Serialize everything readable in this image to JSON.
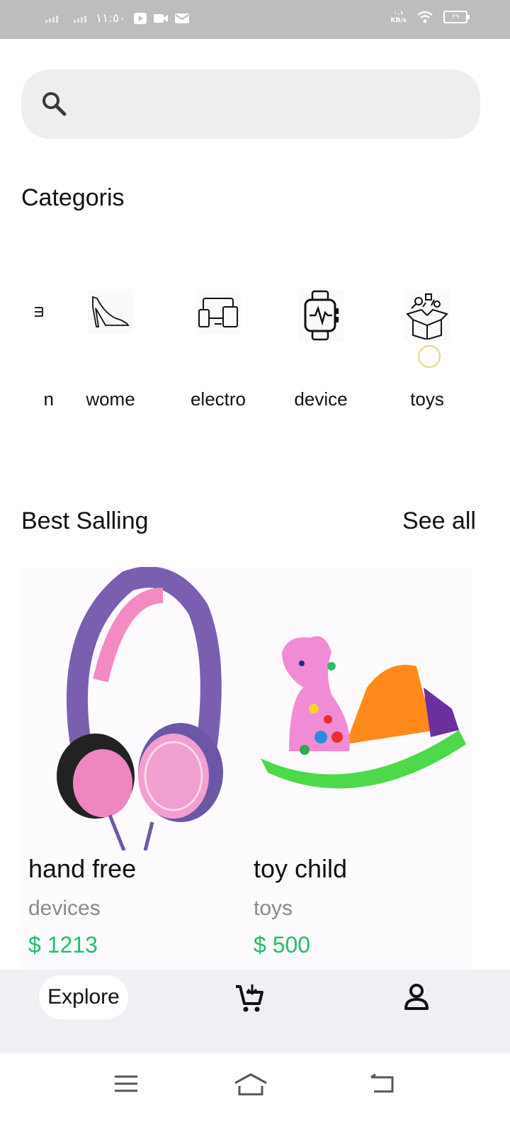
{
  "status_bar": {
    "time": "١١:٥٠",
    "net_speed_top": "٠.١",
    "net_speed_unit": "KB/s",
    "battery": "٢٩"
  },
  "search": {
    "icon": "search-icon"
  },
  "categories": {
    "title": "Categoris",
    "items": [
      {
        "label": "n",
        "icon": "partial-icon"
      },
      {
        "label": "wome",
        "icon": "high-heel-icon"
      },
      {
        "label": "electro",
        "icon": "devices-icon"
      },
      {
        "label": "device",
        "icon": "smartwatch-icon"
      },
      {
        "label": "toys",
        "icon": "toy-box-icon"
      }
    ]
  },
  "best_selling": {
    "title": "Best Salling",
    "see_all": "See all",
    "products": [
      {
        "name": "hand free",
        "category": "devices",
        "price": "$ 1213",
        "image": "headphones-image"
      },
      {
        "name": "toy child",
        "category": "toys",
        "price": "$ 500",
        "image": "rocking-toy-image"
      }
    ]
  },
  "bottom_nav": {
    "explore": "Explore",
    "cart_icon": "cart-icon",
    "profile_icon": "person-icon"
  },
  "colors": {
    "price": "#20c06a",
    "search_bg": "#eeeeee",
    "nav_bg": "#f2eff4",
    "status_bg": "#bdbdbd"
  }
}
